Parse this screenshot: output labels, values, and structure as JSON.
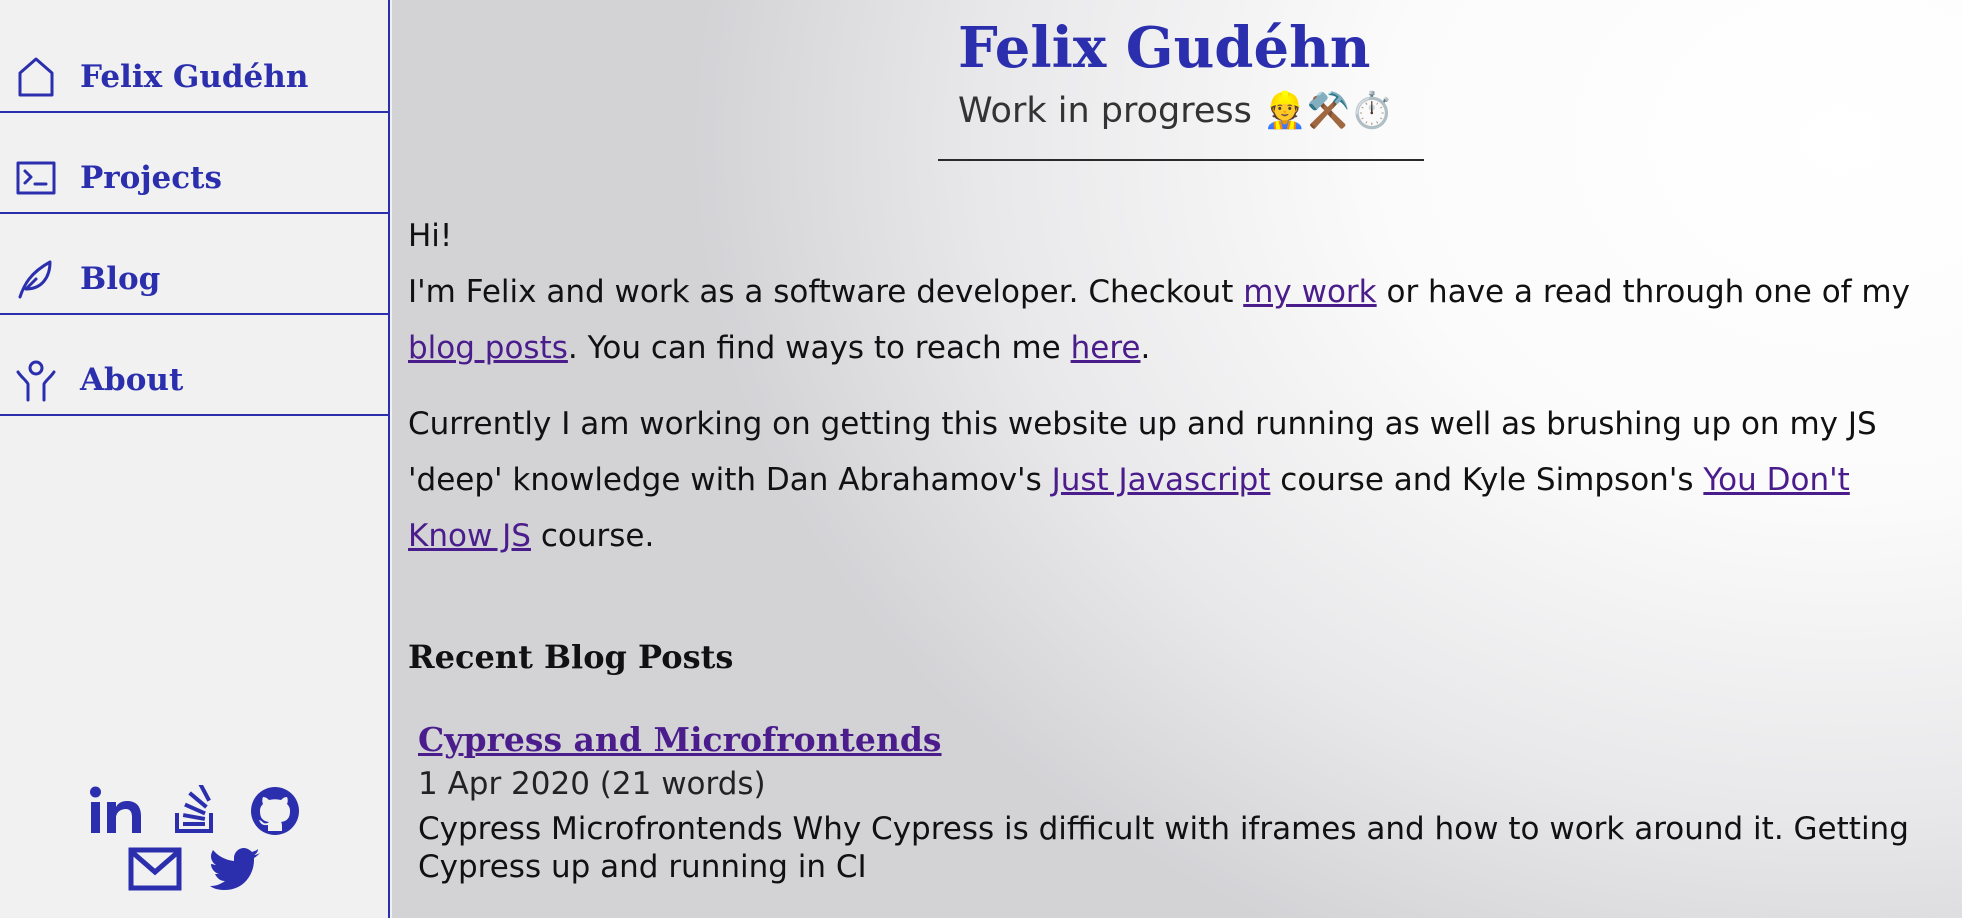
{
  "sidebar": {
    "items": [
      {
        "label": "Felix Gudéhn",
        "icon": "home-icon"
      },
      {
        "label": "Projects",
        "icon": "terminal-icon"
      },
      {
        "label": "Blog",
        "icon": "feather-icon"
      },
      {
        "label": "About",
        "icon": "person-icon"
      }
    ],
    "social": [
      "linkedin-icon",
      "stackoverflow-icon",
      "github-icon",
      "mail-icon",
      "twitter-icon"
    ]
  },
  "header": {
    "title": "Felix Gudéhn",
    "subtitle": "Work in progress 👷⚒️⏱️"
  },
  "intro": {
    "greeting": "Hi!",
    "p1_a": "I'm Felix and work as a software developer. Checkout ",
    "p1_link1": "my work",
    "p1_b": " or have a read through one of my ",
    "p1_link2": "blog posts",
    "p1_c": ". You can find ways to reach me ",
    "p1_link3": "here",
    "p1_d": ".",
    "p2_a": "Currently I am working on getting this website up and running as well as brushing up on my JS 'deep' knowledge with Dan Abrahamov's ",
    "p2_link1": "Just Javascript",
    "p2_b": " course and Kyle Simpson's ",
    "p2_link2": "You Don't Know JS",
    "p2_c": " course."
  },
  "recent": {
    "heading": "Recent Blog Posts",
    "posts": [
      {
        "title": "Cypress and Microfrontends",
        "meta": "1 Apr 2020 (21 words)",
        "description": "Cypress Microfrontends Why Cypress is difficult with iframes and how to work around it. Getting Cypress up and running in CI"
      }
    ]
  },
  "colors": {
    "accent": "#2b2fae",
    "link": "#4b1d8c"
  }
}
